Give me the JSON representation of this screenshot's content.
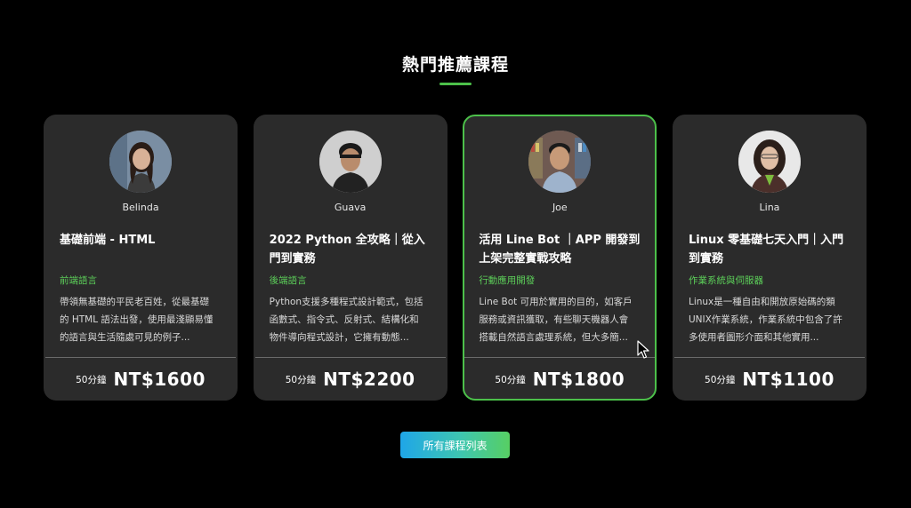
{
  "section": {
    "title": "熱門推薦課程",
    "accent_color": "#4cc04a"
  },
  "courses": [
    {
      "teacher": "Belinda",
      "title": "基礎前端 - HTML",
      "category": "前端語言",
      "description": "帶領無基礎的平民老百姓，從最基礎的 HTML 語法出發，使用最淺顯易懂的語言與生活隨處可見的例子...",
      "duration": "50分鐘",
      "price": "NT$1600",
      "highlighted": false
    },
    {
      "teacher": "Guava",
      "title": "2022 Python 全攻略｜從入門到實務",
      "category": "後端語言",
      "description": "Python支援多種程式設計範式，包括函數式、指令式、反射式、結構化和物件導向程式設計，它擁有動態...",
      "duration": "50分鐘",
      "price": "NT$2200",
      "highlighted": false
    },
    {
      "teacher": "Joe",
      "title": "活用 Line Bot ｜APP 開發到上架完整實戰攻略",
      "category": "行動應用開發",
      "description": "Line Bot 可用於實用的目的，如客戶服務或資訊獲取，有些聊天機器人會搭載自然語言處理系統，但大多簡...",
      "duration": "50分鐘",
      "price": "NT$1800",
      "highlighted": true
    },
    {
      "teacher": "Lina",
      "title": "Linux 零基礎七天入門｜入門到實務",
      "category": "作業系統與伺服器",
      "description": "Linux是一種自由和開放原始碼的類UNIX作業系統，作業系統中包含了許多使用者圖形介面和其他實用...",
      "duration": "50分鐘",
      "price": "NT$1100",
      "highlighted": false
    }
  ],
  "all_courses_button": {
    "label": "所有課程列表"
  }
}
